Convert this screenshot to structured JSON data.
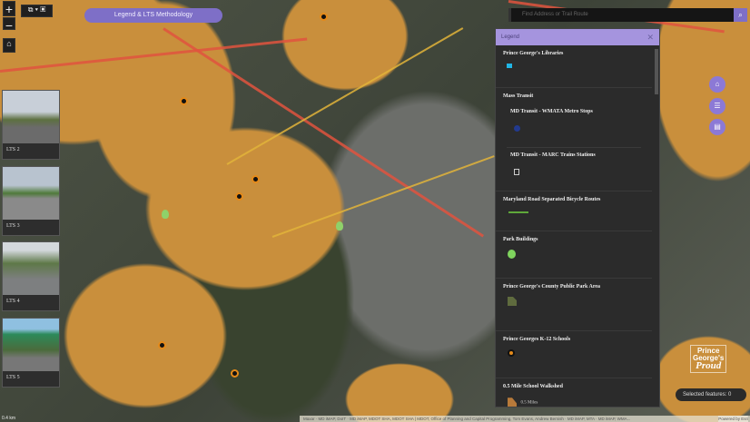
{
  "header": {
    "methodology_button": "Legend & LTS Methodology"
  },
  "map_controls": {
    "zoom_in": "+",
    "zoom_out": "−"
  },
  "lts_thumbnails": [
    {
      "label": "LTS 2"
    },
    {
      "label": "LTS 3"
    },
    {
      "label": "LTS 4"
    },
    {
      "label": "LTS 5"
    }
  ],
  "search": {
    "placeholder": "Find Address or Trail Route"
  },
  "legend": {
    "title": "Legend",
    "sections": [
      {
        "title": "Prince George's Libraries"
      },
      {
        "title": "Mass Transit",
        "subs": [
          "MD Transit - WMATA Metro Stops",
          "MD Transit - MARC Trains Stations"
        ]
      },
      {
        "title": "Maryland Road Separated Bicycle Routes"
      },
      {
        "title": "Park Buildings"
      },
      {
        "title": "Prince George's County Public Park Area"
      },
      {
        "title": "Prince Georges K-12 Schools"
      },
      {
        "title": "0.5 Mile School Walkshed",
        "item_label": "0.5 Miles"
      }
    ]
  },
  "selected_features": "Selected features: 0",
  "logo_text": "Prince George's Proud",
  "scale": "0.4 km",
  "attribution": "Maxar · MD iMAP, DoIT · MD iMAP, MDOT SHA, MDOT SHA | MDOT, Office of Planning and Capital Programming, Tom Evans, Andrew Bernish · MD iMAP, MTA · MD iMAP, WMA...",
  "attribution_right": "Powered by Esri",
  "colors": {
    "accent": "#7e6fc7",
    "walkshed": "#c98f3c",
    "bike_route": "#5fa83a"
  }
}
